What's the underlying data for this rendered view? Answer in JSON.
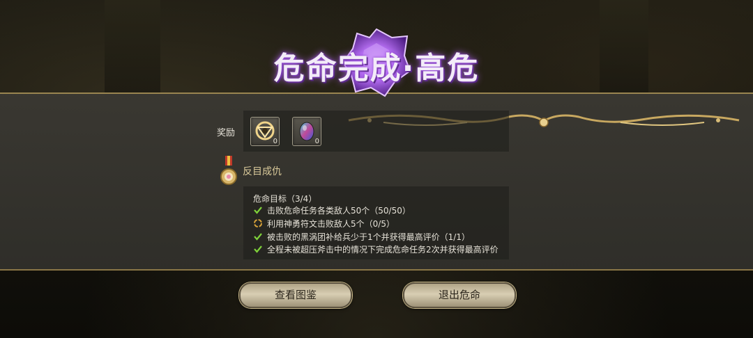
{
  "title": "危命完成·高危",
  "rewards": {
    "label": "奖励",
    "items": [
      {
        "icon": "golden-frame-icon",
        "count": "0"
      },
      {
        "icon": "rainbow-gem-icon",
        "count": "0"
      }
    ]
  },
  "quest": {
    "name": "反目成仇",
    "icon": "medal-icon"
  },
  "objectives": {
    "header": "危命目标（3/4）",
    "items": [
      {
        "text": "击败危命任务各类敌人50个（50/50）",
        "status": "complete"
      },
      {
        "text": "利用神勇符文击败敌人5个（0/5）",
        "status": "incomplete"
      },
      {
        "text": "被击败的黑涡团补给兵少于1个并获得最高评价（1/1）",
        "status": "complete"
      },
      {
        "text": "全程未被超压斧击中的情况下完成危命任务2次并获得最高评价",
        "status": "complete"
      }
    ]
  },
  "buttons": {
    "view_codex": "查看图鉴",
    "exit": "退出危命"
  },
  "colors": {
    "complete": "#7fd23a",
    "incomplete": "#d9a43a",
    "accent_purple": "#a35ee0",
    "gold": "#b89a5a"
  }
}
